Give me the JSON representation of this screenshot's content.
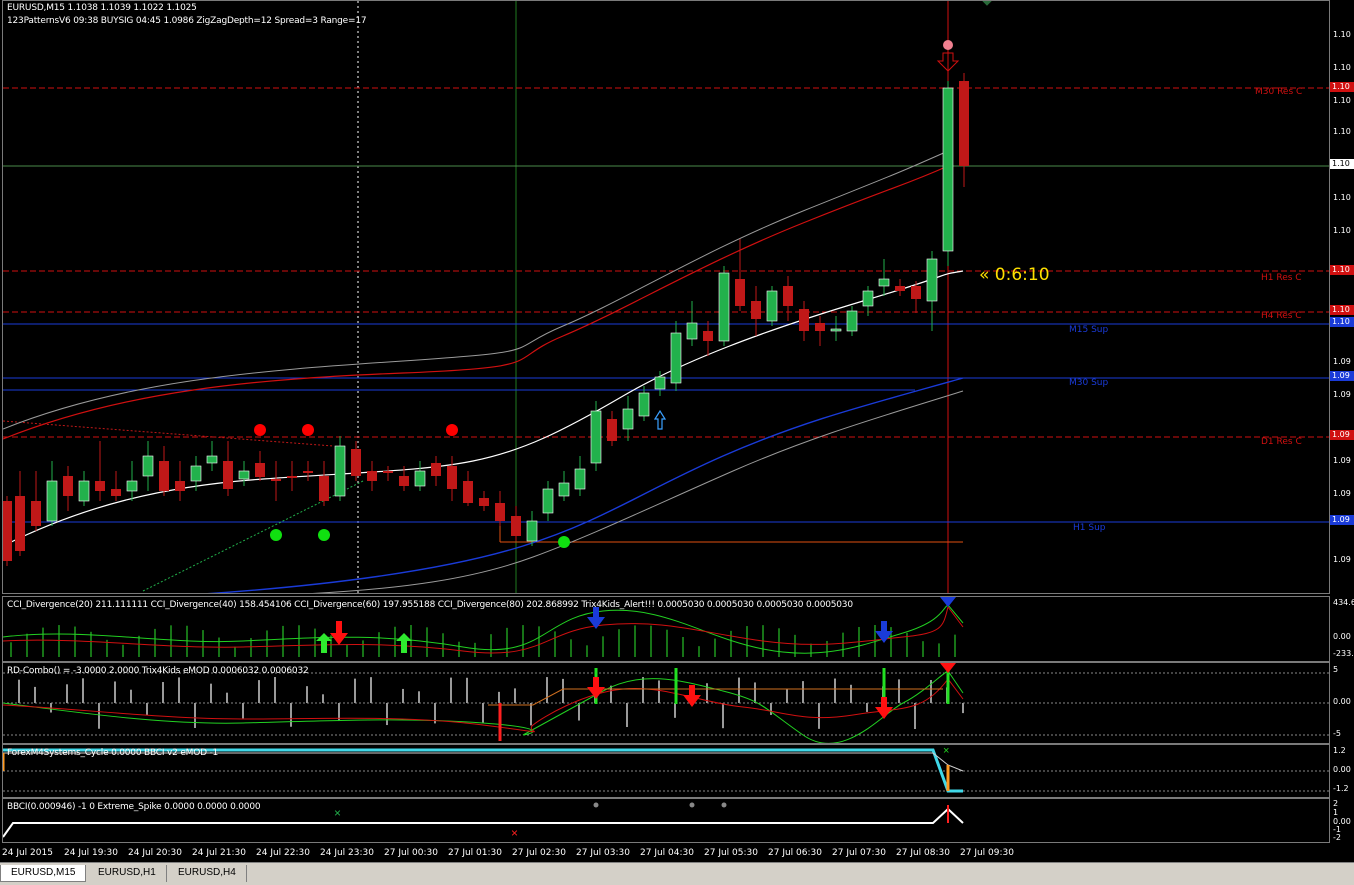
{
  "header": {
    "line1": "EURUSD,M15  1.1038 1.1039 1.1022 1.1025",
    "line2": "123PatternsV6  09:38  BUYSIG  04:45  1.0986  ZigZagDepth=12  Spread=3  Range=17"
  },
  "countdown": "« 0:6:10",
  "levels": [
    {
      "label": "M30 Res C",
      "color": "#d01010"
    },
    {
      "label": "H1 Res C",
      "color": "#d01010"
    },
    {
      "label": "H4 Res C",
      "color": "#d01010"
    },
    {
      "label": "M15 Sup",
      "color": "#1a3bd8"
    },
    {
      "label": "M30 Sup",
      "color": "#1a3bd8"
    },
    {
      "label": "D1 Res C",
      "color": "#d01010"
    },
    {
      "label": "H1 Sup",
      "color": "#1a3bd8"
    }
  ],
  "price_axis": [
    "1.10",
    "1.10",
    "1.10",
    "1.10",
    "1.10",
    "1.10",
    "1.10",
    "1.10",
    "1.10",
    "1.10",
    "1.09",
    "1.09",
    "1.09",
    "1.09",
    "1.09",
    "1.09"
  ],
  "price_boxes": [
    "1.10",
    "1.10",
    "1.10",
    "1.10",
    "1.10",
    "1.09",
    "1.09",
    "1.09"
  ],
  "panels": {
    "p1": {
      "label": "CCI_Divergence(20) 211.111111  CCI_Divergence(40) 158.454106  CCI_Divergence(60) 197.955188  CCI_Divergence(80) 202.868992  Trix4Kids_Alert!!! 0.0005030 0.0005030 0.0005030 0.0005030",
      "axis": [
        "434.6",
        "0.00",
        "-233."
      ]
    },
    "p2": {
      "label": "RD-Combo() = -3.0000 2.0000  Trix4Kids eMOD 0.0006032 0.0006032",
      "axis": [
        "5",
        "0.00",
        "-5"
      ]
    },
    "p3": {
      "label": "ForexM4Systems_Cycle 0.0000  BBCI v2 eMOD -1",
      "axis": [
        "1.2",
        "0.00",
        "-1.2"
      ]
    },
    "p4": {
      "label": "BBCI(0.000946) -1 0  Extreme_Spike 0.0000 0.0000 0.0000",
      "axis": [
        "2",
        "1",
        "0.00",
        "-1",
        "-2"
      ]
    }
  },
  "time_axis": [
    "24 Jul 2015",
    "24 Jul 19:30",
    "24 Jul 20:30",
    "24 Jul 21:30",
    "24 Jul 22:30",
    "24 Jul 23:30",
    "27 Jul 00:30",
    "27 Jul 01:30",
    "27 Jul 02:30",
    "27 Jul 03:30",
    "27 Jul 04:30",
    "27 Jul 05:30",
    "27 Jul 06:30",
    "27 Jul 07:30",
    "27 Jul 08:30",
    "27 Jul 09:30"
  ],
  "tabs": [
    "EURUSD,M15",
    "EURUSD,H1",
    "EURUSD,H4"
  ],
  "colors": {
    "bull": "#22b14c",
    "bear": "#c01818",
    "sup": "#1a3bd8",
    "res": "#d01010",
    "countdown": "#ffe000"
  }
}
